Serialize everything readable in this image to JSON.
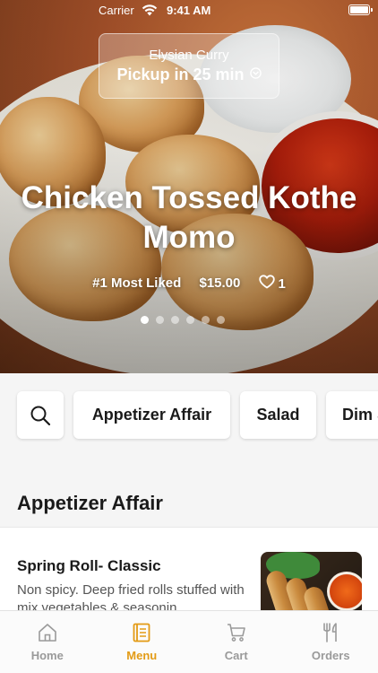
{
  "status_bar": {
    "carrier": "Carrier",
    "time": "9:41 AM"
  },
  "header": {
    "restaurant_name": "Elysian Curry",
    "pickup_text": "Pickup in 25 min"
  },
  "featured": {
    "title": "Chicken Tossed Kothe Momo",
    "badge": "#1 Most Liked",
    "price": "$15.00",
    "likes": "1",
    "slide_count": 6,
    "active_slide": 1
  },
  "categories": [
    "Appetizer Affair",
    "Salad",
    "Dim Sum"
  ],
  "section": {
    "title": "Appetizer Affair",
    "items": [
      {
        "name": "Spring Roll- Classic",
        "description": "Non spicy. Deep fried rolls stuffed with mix vegetables & seasonin..."
      }
    ]
  },
  "tabs": [
    {
      "label": "Home",
      "icon": "home-icon"
    },
    {
      "label": "Menu",
      "icon": "menu-book-icon"
    },
    {
      "label": "Cart",
      "icon": "cart-icon"
    },
    {
      "label": "Orders",
      "icon": "fork-knife-icon"
    }
  ],
  "colors": {
    "accent": "#e39b15",
    "tab_inactive": "#9a9a9a"
  }
}
